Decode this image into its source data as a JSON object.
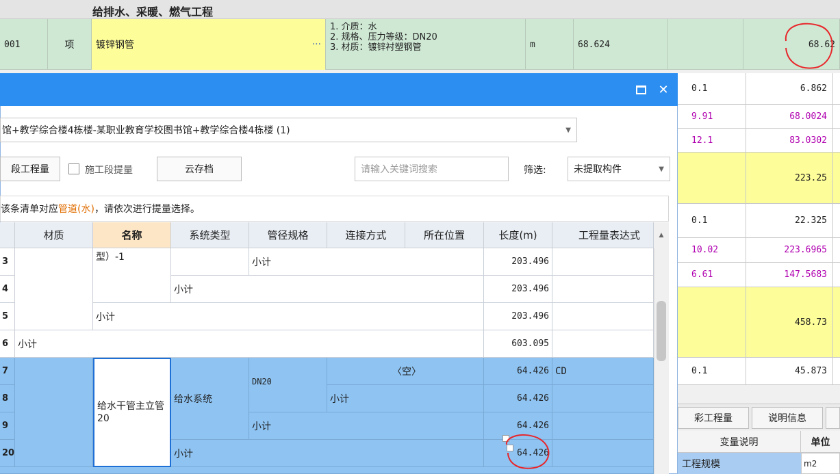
{
  "background": {
    "section_title": "给排水、采暖、燃气工程",
    "row": {
      "code": "001",
      "type": "项",
      "name": "镀锌钢管",
      "ellipsis": "···",
      "desc": "1. 介质：水\n2. 规格、压力等级：DN20\n3. 材质：镀锌衬塑钢管",
      "unit": "m",
      "quantity": "68.624",
      "value": "68.62"
    },
    "right_rows": [
      {
        "a": "0.1",
        "b": "6.862"
      },
      {
        "a": "9.91",
        "b": "68.0024"
      },
      {
        "a": "12.1",
        "b": "83.0302"
      },
      {
        "a": "",
        "b": "223.25"
      },
      {
        "a": "0.1",
        "b": "22.325"
      },
      {
        "a": "10.02",
        "b": "223.6965"
      },
      {
        "a": "6.61",
        "b": "147.5683"
      },
      {
        "a": "",
        "b": "458.73"
      },
      {
        "a": "0.1",
        "b": "45.873"
      }
    ],
    "tabs": [
      "彩工程量",
      "说明信息"
    ],
    "attr_headers": [
      "变量说明",
      "单位"
    ],
    "attr_row": {
      "name": "工程规模",
      "unit": "m2"
    }
  },
  "dialog": {
    "project": "馆+教学综合楼4栋楼-某职业教育学校图书馆+教学综合楼4栋楼 (1)",
    "btn_segment_qty": "段工程量",
    "chk_label": "施工段提量",
    "btn_cloud": "云存档",
    "search_placeholder": "请输入关键词搜索",
    "filter_label": "筛选:",
    "filter_value": "未提取构件",
    "notice_a": "该条清单对应",
    "notice_hl": "管道(水)",
    "notice_b": "，请依次进行提量选择。",
    "headers": [
      "材质",
      "名称",
      "系统类型",
      "管径规格",
      "连接方式",
      "所在位置",
      "长度(m)",
      "工程量表达式"
    ],
    "rows": {
      "n13": "3",
      "n14": "4",
      "n15": "5",
      "n16": "6",
      "n17": "7",
      "n18": "8",
      "n19": "9",
      "n20": "20",
      "name_top": "型）-1",
      "subtotal": "小计",
      "len13": "203.496",
      "len14": "203.496",
      "len15": "203.496",
      "len16": "603.095",
      "pipe_name": "给水干管主立管20",
      "system": "给水系统",
      "spec": "DN20",
      "position": "〈空〉",
      "len17": "64.426",
      "expr17": "CD",
      "len18": "64.426",
      "len19": "64.426",
      "len20": "64.426"
    }
  }
}
